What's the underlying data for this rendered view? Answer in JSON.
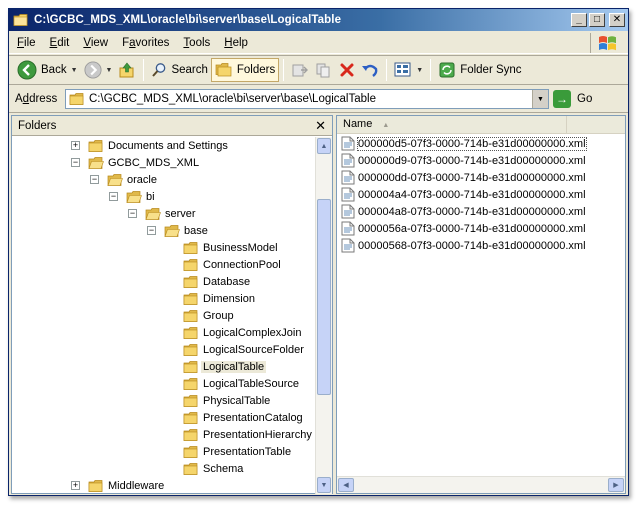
{
  "window": {
    "title": "C:\\GCBC_MDS_XML\\oracle\\bi\\server\\base\\LogicalTable",
    "controls": {
      "minimize": "_",
      "maximize": "□",
      "close": "✕"
    }
  },
  "menu": [
    {
      "accel": "F",
      "rest": "ile"
    },
    {
      "accel": "E",
      "rest": "dit"
    },
    {
      "accel": "V",
      "rest": "iew"
    },
    {
      "accel": "",
      "pre": "F",
      "accel2": "a",
      "rest": "vorites"
    },
    {
      "accel": "T",
      "rest": "ools"
    },
    {
      "accel": "H",
      "rest": "elp"
    }
  ],
  "menu_labels": {
    "file": "File",
    "edit": "Edit",
    "view": "View",
    "favorites": "Favorites",
    "tools": "Tools",
    "help": "Help"
  },
  "toolbar": {
    "back": "Back",
    "search": "Search",
    "folders": "Folders",
    "folder_sync": "Folder Sync"
  },
  "address": {
    "label_accel": "d",
    "label_pre": "A",
    "label_post": "dress",
    "value": "C:\\GCBC_MDS_XML\\oracle\\bi\\server\\base\\LogicalTable",
    "go": "Go"
  },
  "folders_pane": {
    "title": "Folders",
    "close": "✕",
    "tree": [
      {
        "label": "Documents and Settings",
        "depth": 0,
        "expander": "+"
      },
      {
        "label": "GCBC_MDS_XML",
        "depth": 0,
        "expander": "−",
        "open": true
      },
      {
        "label": "oracle",
        "depth": 1,
        "expander": "−",
        "open": true
      },
      {
        "label": "bi",
        "depth": 2,
        "expander": "−",
        "open": true
      },
      {
        "label": "server",
        "depth": 3,
        "expander": "−",
        "open": true
      },
      {
        "label": "base",
        "depth": 4,
        "expander": "−",
        "open": true
      },
      {
        "label": "BusinessModel",
        "depth": 5
      },
      {
        "label": "ConnectionPool",
        "depth": 5
      },
      {
        "label": "Database",
        "depth": 5
      },
      {
        "label": "Dimension",
        "depth": 5
      },
      {
        "label": "Group",
        "depth": 5
      },
      {
        "label": "LogicalComplexJoin",
        "depth": 5
      },
      {
        "label": "LogicalSourceFolder",
        "depth": 5
      },
      {
        "label": "LogicalTable",
        "depth": 5,
        "selected": true
      },
      {
        "label": "LogicalTableSource",
        "depth": 5
      },
      {
        "label": "PhysicalTable",
        "depth": 5
      },
      {
        "label": "PresentationCatalog",
        "depth": 5
      },
      {
        "label": "PresentationHierarchy",
        "depth": 5
      },
      {
        "label": "PresentationTable",
        "depth": 5
      },
      {
        "label": "Schema",
        "depth": 5
      },
      {
        "label": "Middleware",
        "depth": 0,
        "expander": "+"
      }
    ]
  },
  "files_pane": {
    "column_name": "Name",
    "files": [
      {
        "name": "000000d5-07f3-0000-714b-e31d00000000.xml",
        "focused": true
      },
      {
        "name": "000000d9-07f3-0000-714b-e31d00000000.xml"
      },
      {
        "name": "000000dd-07f3-0000-714b-e31d00000000.xml"
      },
      {
        "name": "000004a4-07f3-0000-714b-e31d00000000.xml"
      },
      {
        "name": "000004a8-07f3-0000-714b-e31d00000000.xml"
      },
      {
        "name": "0000056a-07f3-0000-714b-e31d00000000.xml"
      },
      {
        "name": "00000568-07f3-0000-714b-e31d00000000.xml"
      }
    ]
  },
  "colors": {
    "title_gradient_start": "#0a246a",
    "title_gradient_end": "#a6caf0",
    "chrome": "#ece9d8",
    "folder_yellow": "#f5d56b"
  }
}
